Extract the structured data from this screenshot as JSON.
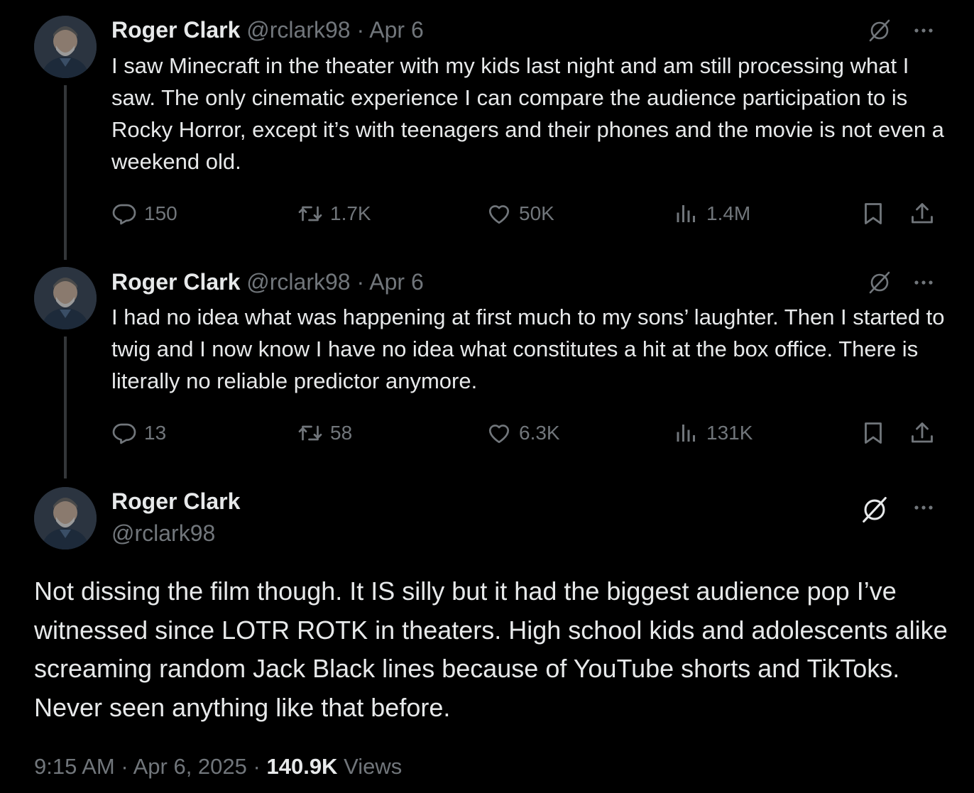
{
  "author": {
    "name": "Roger Clark",
    "handle": "@rclark98"
  },
  "separator": "·",
  "tweets": [
    {
      "date": "Apr 6",
      "text": "I saw Minecraft in the theater with my kids last night and am still processing what I saw. The only cinematic experience I can compare the audience participation to is Rocky Horror, except it’s with teenagers and their phones and the movie is not even a weekend old.",
      "stats": {
        "replies": "150",
        "reposts": "1.7K",
        "likes": "50K",
        "views": "1.4M"
      }
    },
    {
      "date": "Apr 6",
      "text": "I had no idea what was happening at first much to my sons’ laughter. Then I started to twig and I now know I have no idea what constitutes a hit at the box office. There is literally no reliable predictor anymore.",
      "stats": {
        "replies": "13",
        "reposts": "58",
        "likes": "6.3K",
        "views": "131K"
      }
    }
  ],
  "main_tweet": {
    "text": "Not dissing the film though. It IS silly but it had the biggest audience pop I’ve witnessed since LOTR ROTK in theaters. High school kids and adolescents alike screaming random Jack Black lines because of YouTube shorts and TikToks. Never seen anything like that before.",
    "time": "9:15 AM",
    "date": "Apr 6, 2025",
    "views_count": "140.9K",
    "views_label": "Views"
  },
  "icons": {
    "grok": "grok-icon",
    "more": "more-icon",
    "reply": "reply-icon",
    "repost": "repost-icon",
    "like": "like-icon",
    "views": "views-icon",
    "bookmark": "bookmark-icon",
    "share": "share-icon"
  },
  "colors": {
    "background": "#000000",
    "text": "#e7e9ea",
    "muted": "#71767b",
    "thread_line": "#333639"
  }
}
